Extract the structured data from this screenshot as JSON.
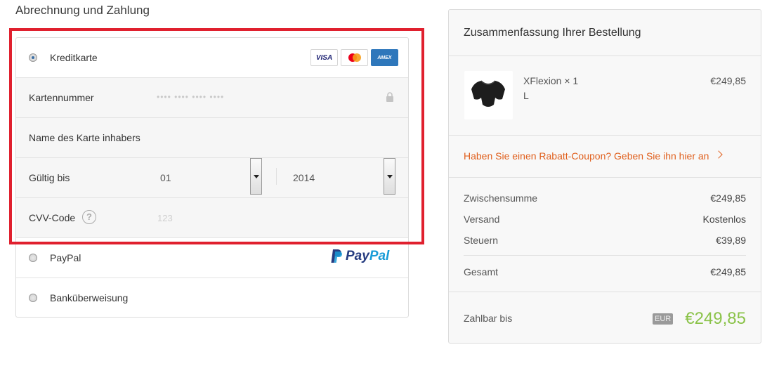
{
  "section_title": "Abrechnung und Zahlung",
  "payment": {
    "credit_card": {
      "label": "Kreditkarte",
      "selected": true,
      "cards": [
        {
          "name": "visa-card-icon",
          "text": "VISA"
        },
        {
          "name": "mastercard-icon",
          "text": ""
        },
        {
          "name": "amex-card-icon",
          "text": "AMEX"
        }
      ]
    },
    "card_number": {
      "label": "Kartennummer",
      "placeholder": "•••• •••• •••• ••••"
    },
    "cardholder": {
      "label": "Name des Karte  inhabers"
    },
    "expiry": {
      "label": "Gültig bis",
      "month": "01",
      "year": "2014"
    },
    "cvv": {
      "label": "CVV-Code",
      "help": "?",
      "placeholder": "123"
    },
    "paypal": {
      "label": "PayPal",
      "logo_text_a": "Pay",
      "logo_text_b": "Pal"
    },
    "bank": {
      "label": "Banküberweisung"
    }
  },
  "summary": {
    "title": "Zusammenfassung Ihrer Bestellung",
    "product": {
      "name": "XFlexion × 1",
      "variant": "L",
      "price": "€249,85"
    },
    "coupon_link": "Haben Sie einen Rabatt-Coupon? Geben Sie ihn hier an",
    "subtotal": {
      "label": "Zwischensumme",
      "value": "€249,85"
    },
    "shipping": {
      "label": "Versand",
      "value": "Kostenlos"
    },
    "tax": {
      "label": "Steuern",
      "value": "€39,89"
    },
    "total": {
      "label": "Gesamt",
      "value": "€249,85"
    },
    "due": {
      "label": "Zahlbar bis",
      "currency": "EUR",
      "amount": "€249,85"
    }
  },
  "colors": {
    "highlight": "#e0202e",
    "coupon": "#e0601e",
    "due_amount": "#8bc34a"
  }
}
